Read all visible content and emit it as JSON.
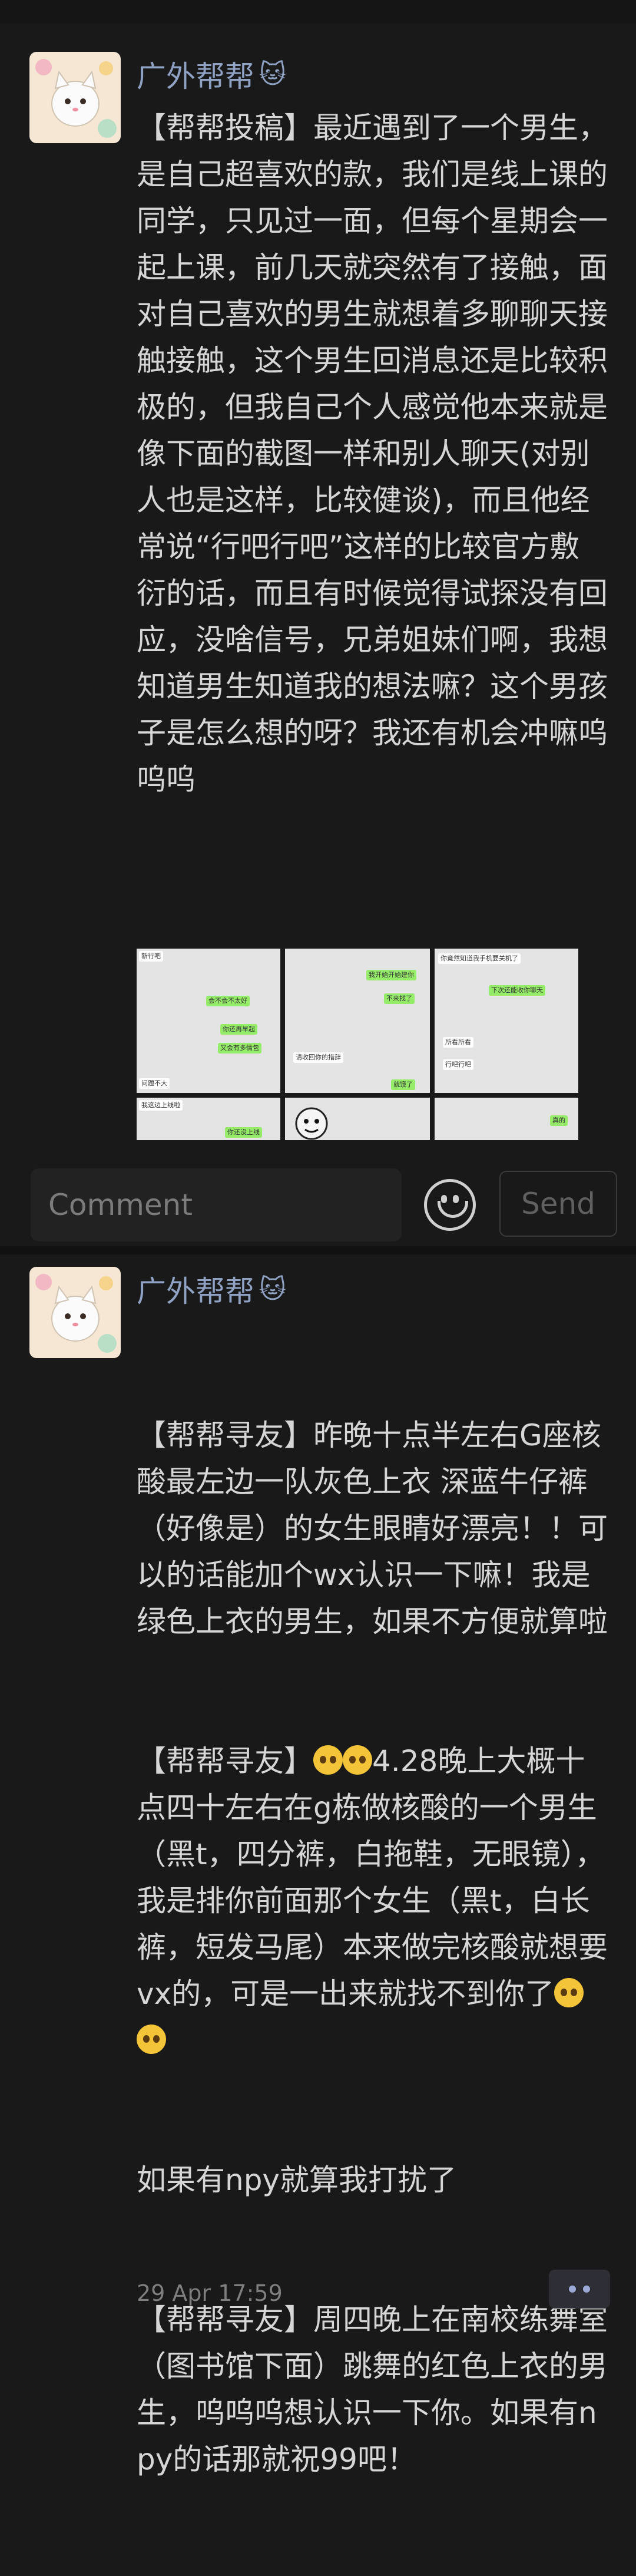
{
  "post1": {
    "author": "广外帮帮",
    "author_icon": "cat-emoji-icon",
    "text": "【帮帮投稿】最近遇到了一个男生，是自己超喜欢的款，我们是线上课的同学，只见过一面，但每个星期会一起上课，前几天就突然有了接触，面对自己喜欢的男生就想着多聊聊天接触接触，这个男生回消息还是比较积极的，但我自己个人感觉他本来就是像下面的截图一样和别人聊天(对别人也是这样，比较健谈)，而且他经常说“行吧行吧”这样的比较官方敷衍的话，而且有时候觉得试探没有回应，没啥信号，兄弟姐妹们啊，我想知道男生知道我的想法嘛？这个男孩子是怎么想的呀？我还有机会冲嘛呜呜呜",
    "screenshots": [
      {
        "bubbles": [
          {
            "text": "新行吧",
            "side": "left"
          },
          {
            "text": "会不会不太好",
            "side": "right"
          },
          {
            "text": "你还再早起",
            "side": "right"
          },
          {
            "text": "又会有多情包",
            "side": "right"
          },
          {
            "text": "问题不大",
            "side": "left"
          }
        ]
      },
      {
        "bubbles": [
          {
            "text": "我开始开始建你",
            "side": "right"
          },
          {
            "text": "不来找了",
            "side": "right"
          },
          {
            "text": "请收回你的措辞",
            "side": "left"
          },
          {
            "text": "就饿了",
            "side": "right"
          }
        ]
      },
      {
        "bubbles": [
          {
            "text": "你竟然知道我手机要关机了",
            "side": "left"
          },
          {
            "text": "下次还能收你聊天",
            "side": "right"
          },
          {
            "text": "所看所看",
            "side": "left"
          },
          {
            "text": "行吧行吧",
            "side": "left"
          }
        ]
      },
      {
        "bubbles": [
          {
            "text": "我这边上线啦",
            "side": "left"
          },
          {
            "text": "你还没上线",
            "side": "right"
          }
        ]
      },
      {
        "bubbles": []
      },
      {
        "bubbles": [
          {
            "text": "真的",
            "side": "right"
          }
        ]
      }
    ]
  },
  "comment": {
    "placeholder": "Comment",
    "send_label": "Send"
  },
  "post2": {
    "author": "广外帮帮",
    "author_icon": "cat-emoji-icon",
    "paragraph1": "【帮帮寻友】昨晚十点半左右G座核酸最左边一队灰色上衣 深蓝牛仔裤（好像是）的女生眼睛好漂亮！！可以的话能加个wx认识一下嘛！我是绿色上衣的男生，如果不方便就算啦",
    "paragraph2_a": "【帮帮寻友】",
    "paragraph2_b": "4.28晚上大概十点四十左右在g栋做核酸的一个男生（黑t，四分裤，白拖鞋，无眼镜），我是排你前面那个女生（黑t，白长裤，短发马尾）本来做完核酸就想要vx的，可是一出来就找不到你了",
    "paragraph2_c": "如果有npy就算我打扰了",
    "paragraph3": "【帮帮寻友】周四晚上在南校练舞室（图书馆下面）跳舞的红色上衣的男生，呜呜呜想认识一下你。如果有npy的话那就祝99吧！",
    "timestamp": "29 Apr 17:59"
  },
  "colors": {
    "background": "#191919",
    "author_name": "#8fa2c4",
    "wechat_green": "#95ec69"
  }
}
